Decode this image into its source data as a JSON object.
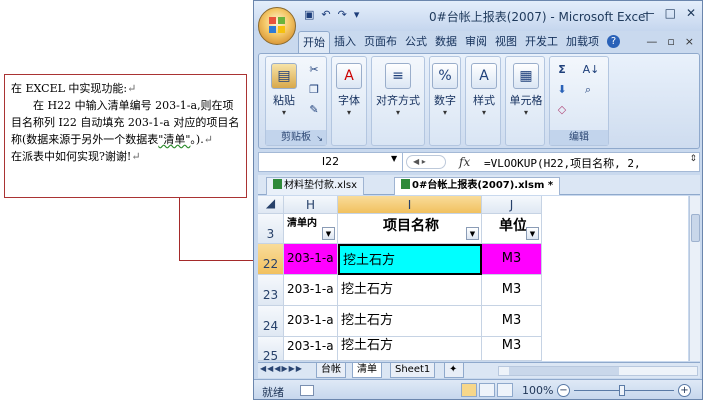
{
  "note": {
    "line1": "在 EXCEL 中实现功能:",
    "line2": "在 H22 中输入清单编号 203-1-a,则在项目名称列 I22 自动填充 203-1-a 对应的项目名称(数据来源于另外一个数据表",
    "line2_wavy": "\"清单\"",
    "line2_end": "。).",
    "line3": "在派表中如何实现?谢谢!",
    "pilcrow": "↵"
  },
  "window": {
    "title": "0#台帐上报表(2007) - Microsoft Excel",
    "qat_save": "▣",
    "qat_undo": "↶",
    "qat_redo": "↷",
    "qat_more": "▾",
    "min": "—",
    "max": "□",
    "close": "✕"
  },
  "ribbon_tabs": [
    "开始",
    "插入",
    "页面布",
    "公式",
    "数据",
    "审阅",
    "视图",
    "开发工",
    "加载项"
  ],
  "ribbon_ctl": {
    "min": "—",
    "restore": "▫",
    "close": "×"
  },
  "ribbon": {
    "clipboard": {
      "paste": "粘贴",
      "group": "剪贴板"
    },
    "font": "字体",
    "alignment": "对齐方式",
    "number": "数字",
    "styles": "样式",
    "cells": "单元格",
    "editing": "编辑",
    "icons": {
      "font": "A",
      "alignment": "≡",
      "number": "%",
      "styles": "A",
      "cells": "▦",
      "sum": "Σ",
      "sort": "A↓",
      "fill": "⬇",
      "find": "⌕",
      "clear": "◇"
    }
  },
  "formula_bar": {
    "name_box": "I22",
    "fx": "fx",
    "formula": "=VLOOKUP(H22,项目名称, 2,"
  },
  "workbook_tabs": [
    {
      "name": "材料垫付款.xlsx"
    },
    {
      "name": "0#台帐上报表(2007).xlsm *"
    }
  ],
  "grid": {
    "columns": [
      "H",
      "I",
      "J"
    ],
    "header_row": {
      "row": "3",
      "h": "清单内",
      "i": "项目名称",
      "j": "单位"
    },
    "rows": [
      {
        "row": "22",
        "h": "203-1-a",
        "i": "挖土石方",
        "j": "M3"
      },
      {
        "row": "23",
        "h": "203-1-a",
        "i": "挖土石方",
        "j": "M3"
      },
      {
        "row": "24",
        "h": "203-1-a",
        "i": "挖土石方",
        "j": "M3"
      },
      {
        "row": "25",
        "h": "203-1-a",
        "i": "挖土石方",
        "j": "M3"
      },
      {
        "row": "26",
        "h": "203-1-a",
        "i": "挖土石方",
        "j": "M3"
      }
    ]
  },
  "sheet_tabs": [
    "台帐",
    "清单",
    "Sheet1"
  ],
  "status": {
    "ready": "就绪",
    "zoom": "100%"
  },
  "colors": {
    "pink": "#ff00ff",
    "cyan": "#00ffff",
    "accent": "#a52a2a"
  }
}
